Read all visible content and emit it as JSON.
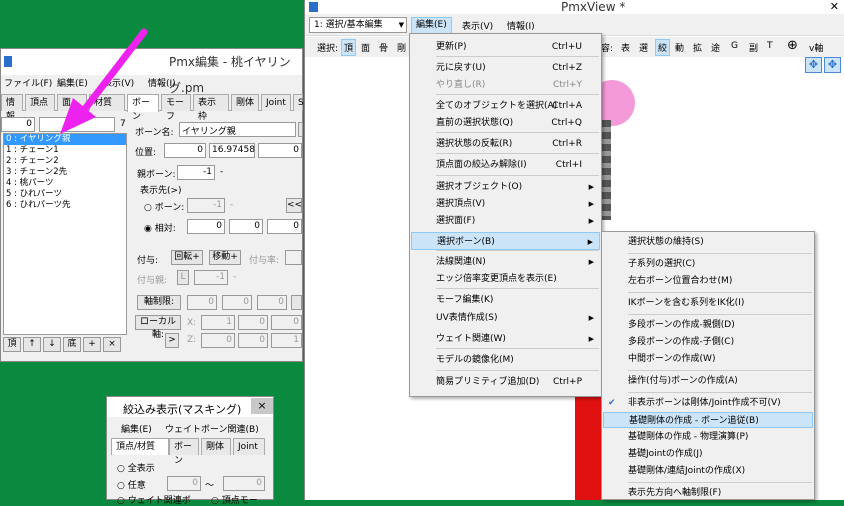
{
  "left_window": {
    "title": "Pmx編集 - 桃イヤリング.pm",
    "menu": [
      "ファイル(F)",
      "編集(E)",
      "表示(V)",
      "情報(I)"
    ],
    "tabs": [
      "情報",
      "頂点",
      "面",
      "材質",
      "ボーン",
      "モーフ",
      "表示枠",
      "剛体",
      "Joint",
      "S"
    ],
    "index_value": "0",
    "count_value": "7",
    "bones": [
      "0 : イヤリング親",
      "1 : チェーン1",
      "2 : チェーン2",
      "3 : チェーン2先",
      "4 : 桃パーツ",
      "5 : ひれパーツ",
      "6 : ひれパーツ先"
    ],
    "bone_name_label": "ボーン名:",
    "bone_name_value": "イヤリング親",
    "position_label": "位置:",
    "position_values": [
      "0",
      "16.97458",
      "0"
    ],
    "parent_label": "親ボーン:",
    "parent_value": "-1",
    "parent_dash": "-",
    "display_dest_label": "表示先(>)",
    "radio_bone_label": "ボーン:",
    "radio_bone_value": "-1",
    "radio_bone_dash": "-",
    "radio_relative_label": "相対:",
    "relative_values": [
      "0",
      "0",
      "0"
    ],
    "double_arrow": "<<",
    "grant_label": "付与:",
    "rotate_btn": "回転+",
    "move_btn": "移動+",
    "grant_rate_label": "付与率:",
    "grant_parent_label": "付与親:",
    "grant_parent_prefix": "L",
    "grant_parent_value": "-1",
    "grant_parent_dash": "-",
    "axis_limit_btn": "軸制限:",
    "axis_values": [
      "0",
      "0",
      "0"
    ],
    "local_axis_btn": "ローカル軸:",
    "x_label": "X:",
    "z_label": "Z:",
    "x_values": [
      "1",
      "0",
      "0"
    ],
    "z_values": [
      "0",
      "0",
      "1"
    ],
    "bottom_buttons": [
      "頂",
      "↑",
      "↓",
      "底",
      "+",
      "×"
    ],
    "chevron_small": ">"
  },
  "mask_window": {
    "title": "絞込み表示(マスキング)",
    "close": "×",
    "menu": [
      "編集(E)",
      "ウェイトボーン関連(B)"
    ],
    "tabs": [
      "頂点/材質",
      "ボーン",
      "剛体",
      "Joint"
    ],
    "radio_all": "全表示",
    "radio_any": "任意",
    "any_from": "0",
    "tilde": "～",
    "any_to": "0",
    "radio_weight": "ウェイト関連ボ",
    "radio_vertex": "頂点モー"
  },
  "view_window": {
    "title": "PmxView *",
    "mode_select": "1: 選択/基本編集",
    "menu": [
      "編集(E)",
      "表示(V)",
      "情報(I)"
    ],
    "toolbar_left": [
      "選択:",
      "頂",
      "面",
      "骨",
      "剛"
    ],
    "toolbar_right": [
      "容:",
      "表",
      "選",
      "絞",
      "動",
      "拡",
      "途",
      "G",
      "副",
      "T",
      "⊕",
      "v軸"
    ],
    "close_btn": "✕"
  },
  "edit_menu": [
    {
      "label": "更新(P)",
      "shortcut": "Ctrl+U"
    },
    {
      "label": "元に戻す(U)",
      "shortcut": "Ctrl+Z"
    },
    {
      "label": "やり直し(R)",
      "shortcut": "Ctrl+Y",
      "dim": true
    },
    {
      "label": "全てのオブジェクトを選択(A)",
      "shortcut": "Ctrl+A"
    },
    {
      "label": "直前の選択状態(Q)",
      "shortcut": "Ctrl+Q"
    },
    {
      "label": "選択状態の反転(R)",
      "shortcut": "Ctrl+R"
    },
    {
      "label": "頂点面の絞込み解除(I)",
      "shortcut": "Ctrl+I"
    },
    {
      "label": "選択オブジェクト(O)",
      "arrow": true
    },
    {
      "label": "選択頂点(V)",
      "arrow": true
    },
    {
      "label": "選択面(F)",
      "arrow": true
    },
    {
      "label": "選択ボーン(B)",
      "arrow": true
    },
    {
      "label": "法線関連(N)",
      "arrow": true
    },
    {
      "label": "エッジ倍率変更頂点を表示(E)"
    },
    {
      "label": "モーフ編集(K)"
    },
    {
      "label": "UV表情作成(S)",
      "arrow": true
    },
    {
      "label": "ウェイト関連(W)",
      "arrow": true
    },
    {
      "label": "モデルの鏡像化(M)"
    },
    {
      "label": "簡易プリミティブ追加(D)",
      "shortcut": "Ctrl+P"
    }
  ],
  "bone_submenu": [
    {
      "label": "選択状態の維持(S)"
    },
    {
      "label": "子系列の選択(C)"
    },
    {
      "label": "左右ボーン位置合わせ(M)"
    },
    {
      "label": "IKボーンを含む系列をIK化(I)"
    },
    {
      "label": "多段ボーンの作成-親側(D)"
    },
    {
      "label": "多段ボーンの作成-子側(C)"
    },
    {
      "label": "中間ボーンの作成(W)"
    },
    {
      "label": "操作(付与)ボーンの作成(A)"
    },
    {
      "label": "非表示ボーンは剛体/Joint作成不可(V)",
      "checked": true
    },
    {
      "label": "基礎剛体の作成 - ボーン追従(B)"
    },
    {
      "label": "基礎剛体の作成 - 物理演算(P)"
    },
    {
      "label": "基礎Jointの作成(J)"
    },
    {
      "label": "基礎剛体/連結Jointの作成(X)"
    },
    {
      "label": "表示先方向へ軸制限(F)"
    }
  ],
  "colors": {
    "desktop": "#0a8a3e",
    "highlight": "#cce4f7",
    "arrow": "#ee22ee",
    "peach": "#f59ad8"
  }
}
